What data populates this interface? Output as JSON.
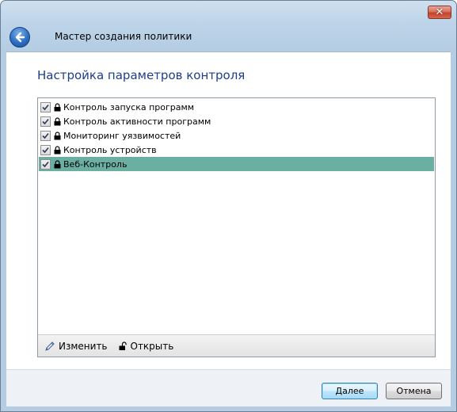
{
  "window": {
    "title": "Мастер создания политики",
    "close_label": "✕"
  },
  "page": {
    "heading": "Настройка параметров контроля"
  },
  "list": {
    "items": [
      {
        "label": "Контроль запуска программ",
        "checked": true,
        "locked": true,
        "selected": false
      },
      {
        "label": "Контроль активности программ",
        "checked": true,
        "locked": true,
        "selected": false
      },
      {
        "label": "Мониторинг уязвимостей",
        "checked": true,
        "locked": true,
        "selected": false
      },
      {
        "label": "Контроль устройств",
        "checked": true,
        "locked": true,
        "selected": false
      },
      {
        "label": "Веб-Контроль",
        "checked": true,
        "locked": true,
        "selected": true
      }
    ],
    "toolbar": {
      "edit_label": "Изменить",
      "edit_icon": "pencil-icon",
      "unlock_label": "Открыть",
      "unlock_icon": "unlocked-padlock-icon"
    }
  },
  "footer": {
    "next_label": "Далее",
    "cancel_label": "Отмена"
  },
  "colors": {
    "heading": "#1e3e8a",
    "selection": "#6bafa3",
    "close_button": "#c4422a"
  }
}
